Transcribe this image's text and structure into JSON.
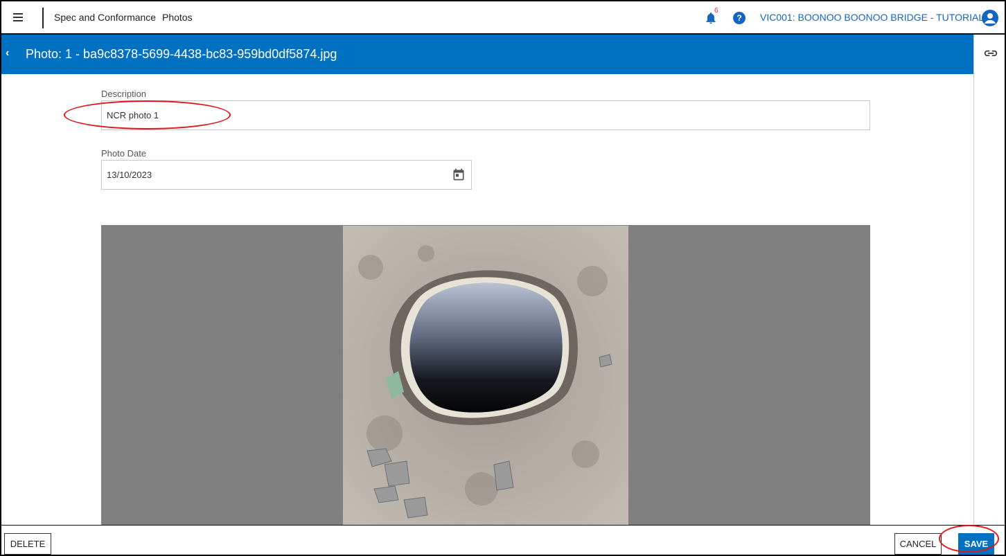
{
  "header": {
    "breadcrumbs": [
      "Spec and Conformance",
      "Photos"
    ],
    "notification_count": "6",
    "help_glyph": "?",
    "project": "VIC001: BOONOO BOONOO BRIDGE - TUTORIAL"
  },
  "photo": {
    "title": "Photo: 1 - ba9c8378-5699-4438-bc83-959bd0df5874.jpg",
    "back_glyph": "‹"
  },
  "form": {
    "description_label": "Description",
    "description_value": "NCR photo 1",
    "date_label": "Photo Date",
    "date_value": "13/10/2023"
  },
  "footer": {
    "delete_label": "DELETE",
    "cancel_label": "CANCEL",
    "save_label": "SAVE"
  },
  "colors": {
    "primary": "#0070c0",
    "annotation": "#e0161b",
    "viewer_background": "#808080",
    "notification": "#d32f2f"
  },
  "icons": [
    "menu-icon",
    "bell-icon",
    "help-icon",
    "account-icon",
    "back-chevron-icon",
    "link-icon",
    "calendar-icon"
  ]
}
